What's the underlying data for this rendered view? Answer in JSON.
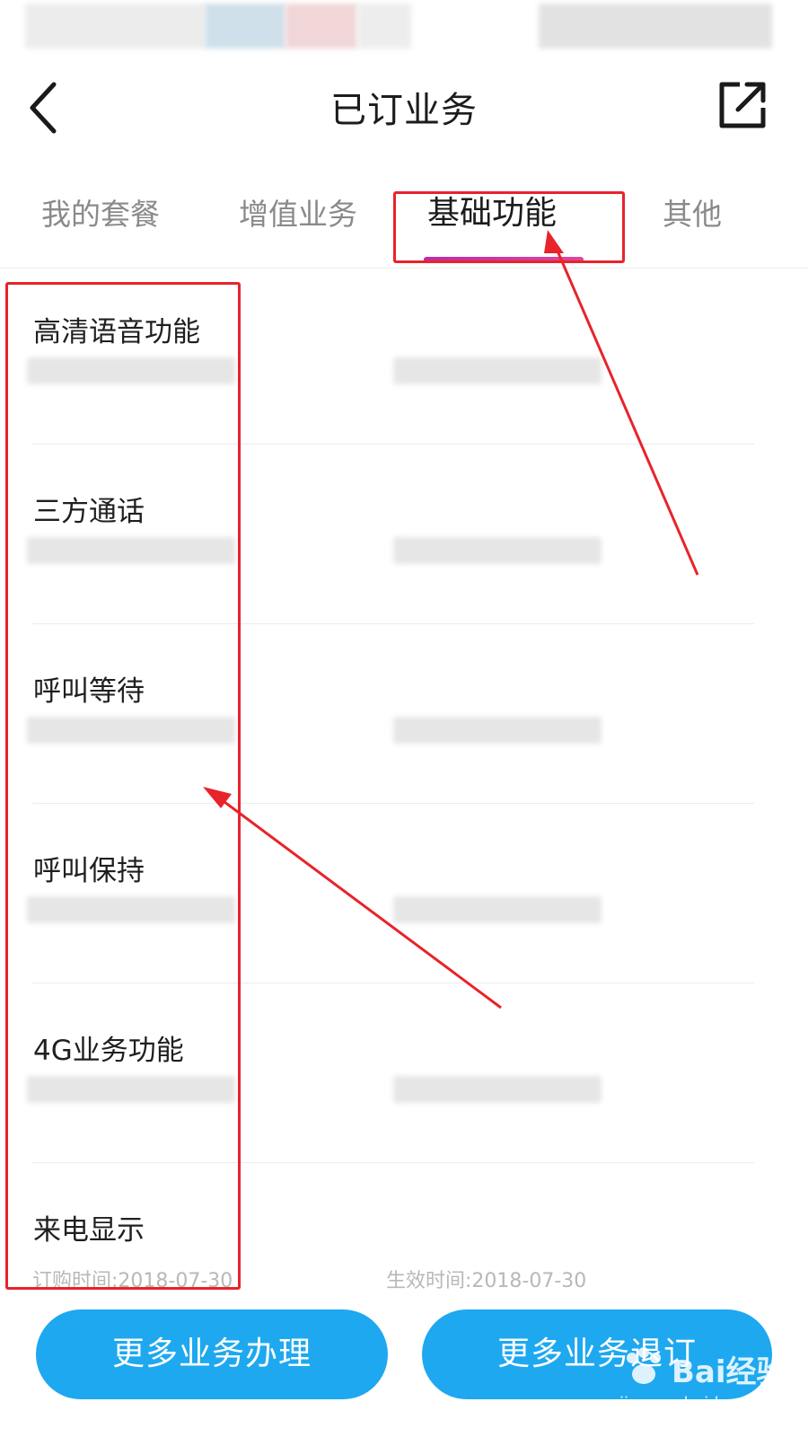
{
  "header": {
    "title": "已订业务"
  },
  "tabs": [
    {
      "label": "我的套餐"
    },
    {
      "label": "增值业务"
    },
    {
      "label": "基础功能"
    },
    {
      "label": "其他"
    }
  ],
  "active_tab": "基础功能",
  "list": {
    "items": [
      {
        "title": "高清语音功能"
      },
      {
        "title": "三方通话"
      },
      {
        "title": "呼叫等待"
      },
      {
        "title": "呼叫保持"
      },
      {
        "title": "4G业务功能"
      },
      {
        "title": "来电显示",
        "order_time": "订购时间:2018-07-30",
        "effective_time": "生效时间:2018-07-30"
      }
    ]
  },
  "footer": {
    "more_button": "更多业务办理",
    "cancel_button": "更多业务退订"
  },
  "watermark": {
    "brand": "Bai经验",
    "url": "jingyan.baidu.com"
  },
  "colors": {
    "accent": "#1ea8f0",
    "annotation": "#e8232a",
    "tab_underline": "#d63a9f"
  }
}
